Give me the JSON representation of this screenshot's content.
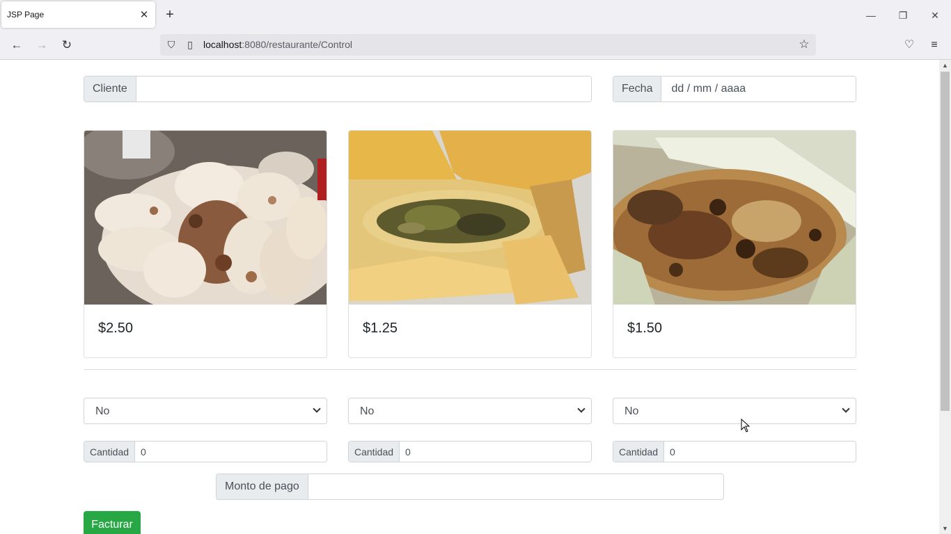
{
  "browser": {
    "tab_title": "JSP Page",
    "url_host": "localhost",
    "url_rest": ":8080/restaurante/Control"
  },
  "form": {
    "cliente_label": "Cliente",
    "cliente_value": "",
    "fecha_label": "Fecha",
    "fecha_placeholder": "dd / mm / aaaa",
    "monto_label": "Monto de pago",
    "monto_value": "",
    "submit_label": "Facturar"
  },
  "products": [
    {
      "image_icon": "pupusas-photo",
      "price": "$2.50",
      "select_value": "No",
      "cantidad_label": "Cantidad",
      "cantidad_value": "0"
    },
    {
      "image_icon": "tamal-photo",
      "price": "$1.25",
      "select_value": "No",
      "cantidad_label": "Cantidad",
      "cantidad_value": "0"
    },
    {
      "image_icon": "tamal-elote-photo",
      "price": "$1.50",
      "select_value": "No",
      "cantidad_label": "Cantidad",
      "cantidad_value": "0"
    }
  ],
  "colors": {
    "primary_button": "#28a745",
    "input_addon_bg": "#e9ecef",
    "border": "#ced4da"
  }
}
